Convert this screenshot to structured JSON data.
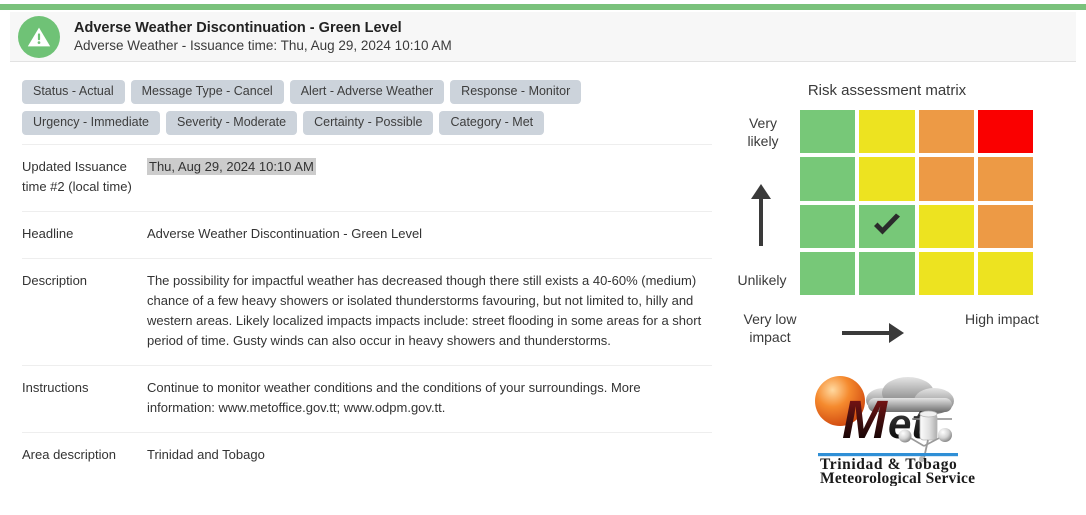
{
  "accent_color": "#7ac27c",
  "header": {
    "icon": "warning-triangle-icon",
    "title": "Adverse Weather Discontinuation - Green Level",
    "subtitle": "Adverse Weather - Issuance time: Thu, Aug 29, 2024 10:10 AM"
  },
  "tags": [
    "Status - Actual",
    "Message Type - Cancel",
    "Alert - Adverse Weather",
    "Response - Monitor",
    "Urgency - Immediate",
    "Severity - Moderate",
    "Certainty - Possible",
    "Category - Met"
  ],
  "details": [
    {
      "label": "Updated Issuance time #2 (local time)",
      "value": "Thu, Aug 29, 2024 10:10 AM",
      "highlighted": true
    },
    {
      "label": "Headline",
      "value": "Adverse Weather Discontinuation - Green Level",
      "highlighted": false
    },
    {
      "label": "Description",
      "value": "The possibility for impactful weather has decreased though there still exists a 40-60% (medium) chance of a few heavy showers or isolated thunderstorms favouring, but not limited to, hilly and western areas. Likely localized impacts impacts include: street flooding in some areas for a short period of time. Gusty winds can also occur in heavy showers and thunderstorms.",
      "highlighted": false
    },
    {
      "label": "Instructions",
      "value": "Continue to monitor weather conditions and the conditions of your surroundings. More information: www.metoffice.gov.tt; www.odpm.gov.tt.",
      "highlighted": false
    },
    {
      "label": "Area description",
      "value": "Trinidad and Tobago",
      "highlighted": false
    }
  ],
  "risk_matrix": {
    "title": "Risk assessment matrix",
    "y_axis_top_label": "Very likely",
    "y_axis_bottom_label": "Unlikely",
    "x_axis_left_label": "Very low impact",
    "x_axis_right_label": "High impact",
    "y_arrow": "up-arrow-icon",
    "x_arrow": "right-arrow-icon",
    "colors": {
      "green": "#77c878",
      "yellow": "#ede320",
      "orange": "#ed9a45",
      "red": "#fa0000"
    },
    "selected_marker": "check-icon",
    "selected_row": 2,
    "selected_col": 1,
    "cells": [
      [
        "green",
        "yellow",
        "orange",
        "red"
      ],
      [
        "green",
        "yellow",
        "orange",
        "orange"
      ],
      [
        "green",
        "green",
        "yellow",
        "orange"
      ],
      [
        "green",
        "green",
        "yellow",
        "yellow"
      ]
    ]
  },
  "logo": {
    "wordmark": "Met",
    "line1": "Trinidad & Tobago",
    "line2": "Meteorological Service"
  }
}
